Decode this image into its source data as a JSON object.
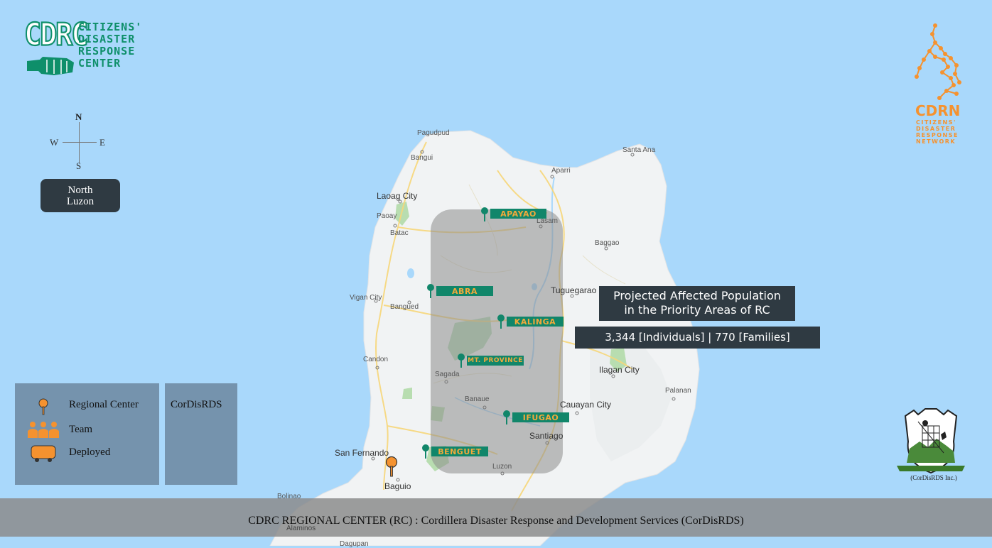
{
  "header": {
    "cdrc_logo": {
      "mark": "CDRC",
      "line1": "CITIZENS'",
      "line2": "DISASTER",
      "line3": "RESPONSE",
      "line4": "CENTER"
    },
    "cdrn_logo": {
      "mark": "CDRN",
      "line1": "CITIZENS'",
      "line2": "DISASTER",
      "line3": "RESPONSE",
      "line4": "NETWORK"
    },
    "cordisrds_logo": {
      "caption": "(CorDisRDS Inc.)"
    }
  },
  "compass": {
    "n": "N",
    "s": "S",
    "e": "E",
    "w": "W"
  },
  "region_label": {
    "line1": "North",
    "line2": "Luzon"
  },
  "map_labels": {
    "pagudpud": "Pagudpud",
    "bangui": "Bangui",
    "santa_ana": "Santa Ana",
    "aparri": "Aparri",
    "laoag": "Laoag City",
    "paoay": "Paoay",
    "batac": "Batac",
    "lasam": "Lasam",
    "baggao": "Baggao",
    "tuguegarao": "Tuguegarao",
    "vigan": "Vigan City",
    "bangued": "Bangued",
    "candon": "Candon",
    "ilagan": "Ilagan City",
    "palanan": "Palanan",
    "sagada": "Sagada",
    "banaue": "Banaue",
    "cauayan": "Cauayan City",
    "santiago": "Santiago",
    "san_fernando": "San Fernando",
    "luzon": "Luzon",
    "baguio": "Baguio",
    "bolinao": "Bolinao",
    "alaminos": "Alaminos",
    "dagupan": "Dagupan"
  },
  "provinces": {
    "apayao": "APAYAO",
    "abra": "ABRA",
    "kalinga": "KALINGA",
    "mt_province": "MT. PROVINCE",
    "ifugao": "IFUGAO",
    "benguet": "BENGUET"
  },
  "callout": {
    "title_line1": "Projected Affected Population",
    "title_line2": "in the Priority Areas of RC",
    "stats": "3,344 [Individuals] | 770 [Families]"
  },
  "legend": {
    "regional_center": "Regional Center",
    "team": "Team",
    "deployed": "Deployed",
    "rc_name": "CorDisRDS"
  },
  "footer": {
    "text": "CDRC REGIONAL CENTER (RC) : Cordillera Disaster Response and Development Services (CorDisRDS)"
  },
  "colors": {
    "sea": "#a9d8fb",
    "land": "#f1f3f4",
    "provinces": "#11866a",
    "accent": "#f2a93b",
    "cdrc_green": "#0e8f6a",
    "cdrn_orange": "#f5922f"
  }
}
